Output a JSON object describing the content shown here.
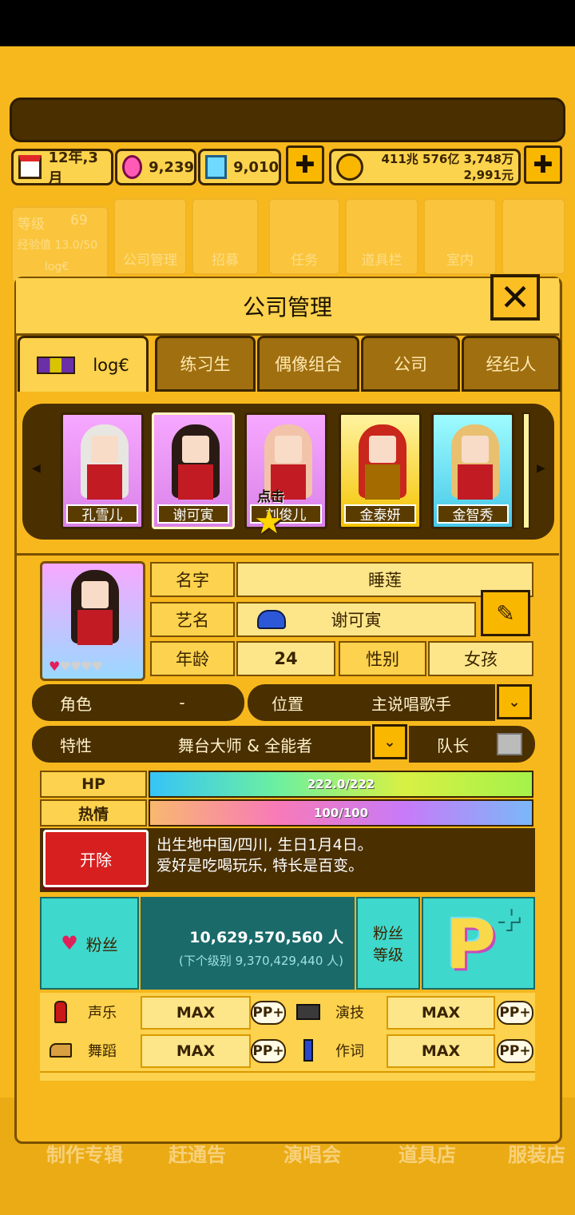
{
  "topbar": {
    "date": "12年,3月",
    "gems": "9,239",
    "diamonds": "9,010",
    "money_line1": "411兆 576亿 3,748万",
    "money_line2": "2,991元",
    "plus_label": "✚"
  },
  "background": {
    "level_label": "等级",
    "level_value": "69",
    "exp_label": "经验值 13.0/50",
    "logo_text": "log€",
    "tiles": [
      "公司管理",
      "招募",
      "任务",
      "道具栏",
      "室内"
    ],
    "bottom_nav": [
      "制作专辑",
      "赶通告",
      "演唱会",
      "道具店",
      "服装店"
    ]
  },
  "panel": {
    "title": "公司管理",
    "close_label": "✕",
    "tabs": {
      "group_logo": "log€",
      "trainee": "练习生",
      "idol_group": "偶像组合",
      "company": "公司",
      "agent": "经纪人"
    },
    "roster": {
      "members": [
        {
          "name": "孔雪儿"
        },
        {
          "name": "谢可寅"
        },
        {
          "name": "刘俊儿"
        },
        {
          "name": "金泰妍"
        },
        {
          "name": "金智秀"
        }
      ],
      "click_hint": "点击"
    },
    "profile": {
      "name_label": "名字",
      "name_value": "睡莲",
      "stage_name_label": "艺名",
      "stage_name_value": "谢可寅",
      "age_label": "年龄",
      "age_value": "24",
      "gender_label": "性别",
      "gender_value": "女孩",
      "role_label": "角色",
      "role_value": "-",
      "position_label": "位置",
      "position_value": "主说唱歌手",
      "trait_label": "特性",
      "trait_value": "舞台大师 & 全能者",
      "leader_label": "队长",
      "hearts_filled": 1,
      "hearts_total": 5
    },
    "stats": {
      "hp_label": "HP",
      "hp_text": "222.0/222",
      "hp_fraction": 1.0,
      "passion_label": "热情",
      "passion_text": "100/100",
      "passion_fraction": 1.0
    },
    "fire_label": "开除",
    "bio_line1": "出生地中国/四川, 生日1月4日。",
    "bio_line2": "爱好是吃喝玩乐, 特长是百变。",
    "fans": {
      "label": "粉丝",
      "count": "10,629,570,560 人",
      "next_level": "(下个级别 9,370,429,440 人)",
      "level_label_1": "粉丝",
      "level_label_2": "等级",
      "level_badge": "P"
    },
    "skills": [
      {
        "name": "声乐",
        "value": "MAX",
        "pp": "PP+",
        "icon": "microphone-icon"
      },
      {
        "name": "演技",
        "value": "MAX",
        "pp": "PP+",
        "icon": "camera-icon"
      },
      {
        "name": "舞蹈",
        "value": "MAX",
        "pp": "PP+",
        "icon": "shoe-icon"
      },
      {
        "name": "作词",
        "value": "MAX",
        "pp": "PP+",
        "icon": "pen-icon"
      }
    ]
  }
}
